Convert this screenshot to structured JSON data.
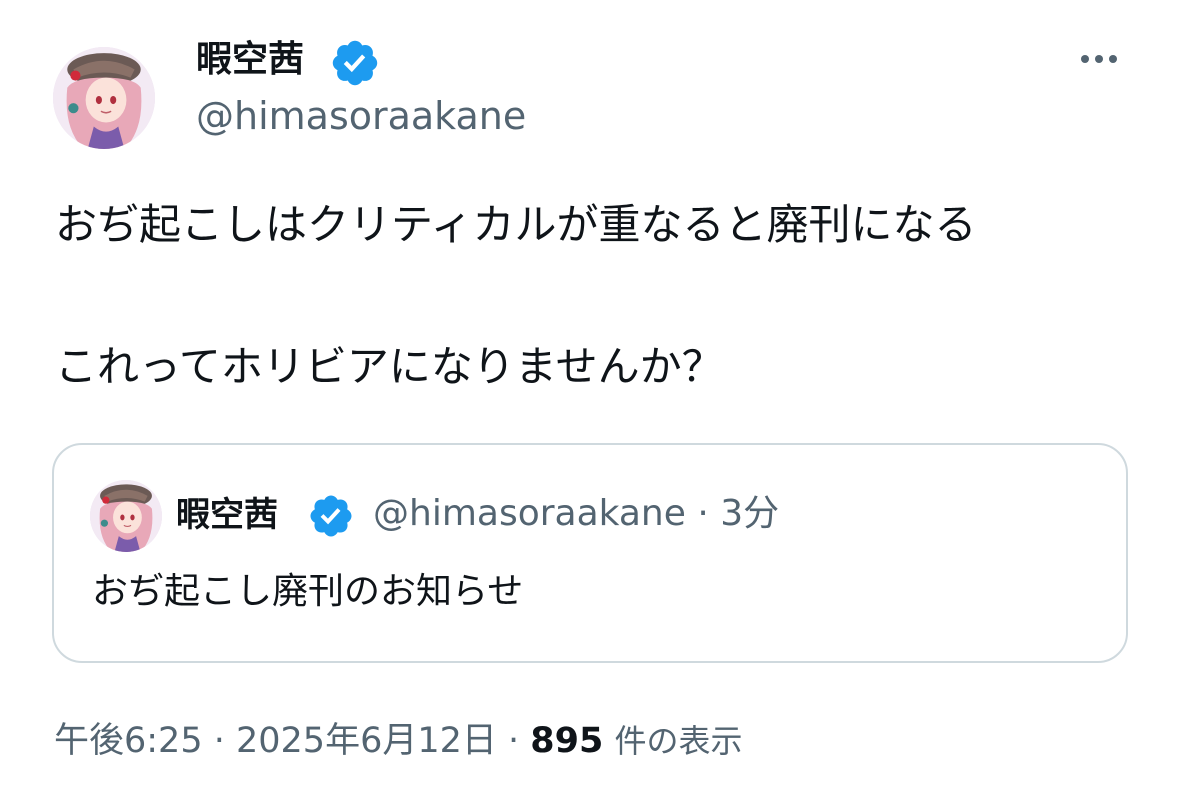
{
  "author": {
    "display_name": "暇空茜",
    "handle": "@himasoraakane",
    "verified": true,
    "avatar_icon": "anime-character-avatar"
  },
  "menu": {
    "icon": "more-icon"
  },
  "tweet": {
    "line1": "おぢ起こしはクリティカルが重なると廃刊になる",
    "line2": "これってホリビアになりませんか？"
  },
  "quote": {
    "display_name": "暇空茜",
    "handle": "@himasoraakane",
    "separator": " · ",
    "time_ago": "3分",
    "text": "おぢ起こし廃刊のお知らせ"
  },
  "meta": {
    "time": "午後6:25",
    "separator": " · ",
    "date": "2025年6月12日",
    "views_count": "895",
    "views_label": "件の表示"
  },
  "colors": {
    "verified_blue": "#1d9bf0",
    "text_primary": "#0f1419",
    "text_secondary": "#536471",
    "card_border": "#cfd9de"
  }
}
